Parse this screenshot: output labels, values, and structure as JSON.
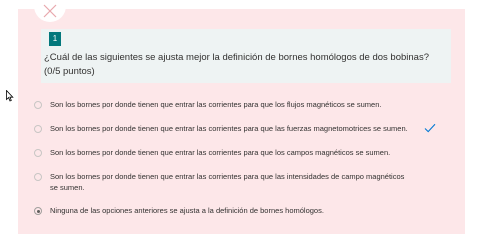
{
  "question": {
    "number": "1",
    "title": "¿Cuál de las siguientes se ajusta mejor la definición de bornes homólogos de dos bobinas?",
    "points": "(0/5 puntos)"
  },
  "options": [
    {
      "lines": [
        "Son los bornes por donde tienen que entrar las corrientes para que los flujos magnéticos se sumen."
      ],
      "selected": false,
      "correct": false
    },
    {
      "lines": [
        "Son los bornes por donde tienen que entrar las corrientes para que las fuerzas magnetomotrices se sumen."
      ],
      "selected": false,
      "correct": true
    },
    {
      "lines": [
        "Son los bornes por donde tienen que entrar las corrientes para que los campos magnéticos se sumen."
      ],
      "selected": false,
      "correct": false
    },
    {
      "lines": [
        "Son los bornes por donde tienen que entrar las corrientes para que las intensidades de campo magnéticos",
        "se sumen."
      ],
      "selected": false,
      "correct": false
    },
    {
      "lines": [
        "Ninguna de las opciones anteriores se ajusta a la definición de bornes homólogos."
      ],
      "selected": true,
      "correct": false
    }
  ],
  "icons": {
    "badge": "close-x-icon",
    "correct_marker": "checkmark-icon",
    "pointer": "mouse-cursor-icon"
  },
  "colors": {
    "incorrect_background": "#fde7e9",
    "question_box": "#eef3f3",
    "number_badge": "#03787c",
    "close_icon": "#e8a8ad",
    "checkmark": "#0078d4"
  }
}
